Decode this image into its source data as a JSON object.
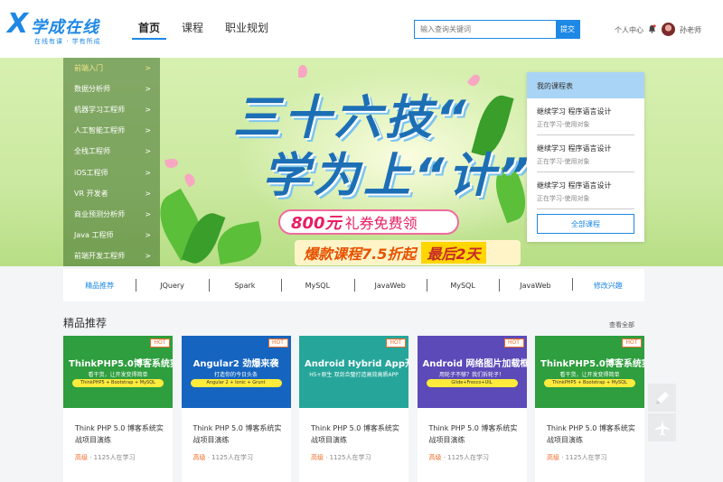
{
  "brand": {
    "mark": "X",
    "title": "学成在线",
    "subtitle": "在线有课 · 学有所成"
  },
  "nav": [
    {
      "label": "首页",
      "active": true
    },
    {
      "label": "课程"
    },
    {
      "label": "职业规划"
    }
  ],
  "search": {
    "placeholder": "输入查询关键词",
    "button": "提交"
  },
  "user": {
    "center": "个人中心",
    "name": "孙老师"
  },
  "categories": [
    {
      "label": "前端入门",
      "arrow": ">"
    },
    {
      "label": "数据分析师",
      "arrow": ">"
    },
    {
      "label": "机器学习工程师",
      "arrow": ">"
    },
    {
      "label": "人工智能工程师",
      "arrow": ">"
    },
    {
      "label": "全栈工程师",
      "arrow": ">"
    },
    {
      "label": "iOS工程师",
      "arrow": ">"
    },
    {
      "label": "VR 开发者",
      "arrow": ">"
    },
    {
      "label": "商业预测分析师",
      "arrow": ">"
    },
    {
      "label": "Java 工程师",
      "arrow": ">"
    },
    {
      "label": "前端开发工程师",
      "arrow": ">"
    }
  ],
  "banner": {
    "slogan1": "三十六技“",
    "slogan2": "学为上“计”",
    "promo1_amount": "800元",
    "promo1_text": "礼券免费领",
    "promo2_text": "爆款课程7.5折起",
    "promo2_tag": "最后2天"
  },
  "my_courses": {
    "title": "我的课程表",
    "items": [
      {
        "title": "继续学习 程序语言设计",
        "sub": "正在学习-使用对象"
      },
      {
        "title": "继续学习 程序语言设计",
        "sub": "正在学习-使用对象"
      },
      {
        "title": "继续学习 程序语言设计",
        "sub": "正在学习-使用对象"
      }
    ],
    "button": "全部课程"
  },
  "tags": [
    "精品推荐",
    "JQuery",
    "Spark",
    "MySQL",
    "JavaWeb",
    "MySQL",
    "JavaWeb",
    "修改兴趣"
  ],
  "section": {
    "title": "精品推荐",
    "more": "查看全部"
  },
  "cards": [
    {
      "img_title": "ThinkPHP5.0博客系统实战",
      "img_sub": "看干货，让开发变得简单",
      "img_pill": "ThinkPHP5 + Bootstrap + MySQL",
      "hot": "HOT",
      "title": "Think PHP 5.0 博客系统实战项目演练",
      "level": "高级",
      "learners": " · 1125人在学习",
      "color": "#2e9e3e"
    },
    {
      "img_title": "Angular2 劲爆来袭",
      "img_sub": "打造你的今日头条",
      "img_pill": "Angular 2 + Ionic + Grunt",
      "hot": "HOT",
      "title": "Think PHP 5.0 博客系统实战项目演练",
      "level": "高级",
      "learners": " · 1125人在学习",
      "color": "#1565c0"
    },
    {
      "img_title": "Android Hybrid App开发实战",
      "img_sub": "H5+原生 双剑合璧打造高效高质APP",
      "img_pill": "",
      "hot": "HOT",
      "title": "Think PHP 5.0 博客系统实战项目演练",
      "level": "高级",
      "learners": " · 1125人在学习",
      "color": "#26a69a"
    },
    {
      "img_title": "Android 网络图片加载框架详解",
      "img_sub": "用轮子不够？我们拆轮子！",
      "img_pill": "Glide+Fresco+UIL",
      "hot": "HOT",
      "title": "Think PHP 5.0 博客系统实战项目演练",
      "level": "高级",
      "learners": " · 1125人在学习",
      "color": "#5c4ab8"
    },
    {
      "img_title": "ThinkPHP5.0博客系统实战",
      "img_sub": "看干货，让开发变得简单",
      "img_pill": "ThinkPHP5 + Bootstrap + MySQL",
      "hot": "HOT",
      "title": "Think PHP 5.0 博客系统实战项目演练",
      "level": "高级",
      "learners": " · 1125人在学习",
      "color": "#2e9e3e"
    }
  ]
}
